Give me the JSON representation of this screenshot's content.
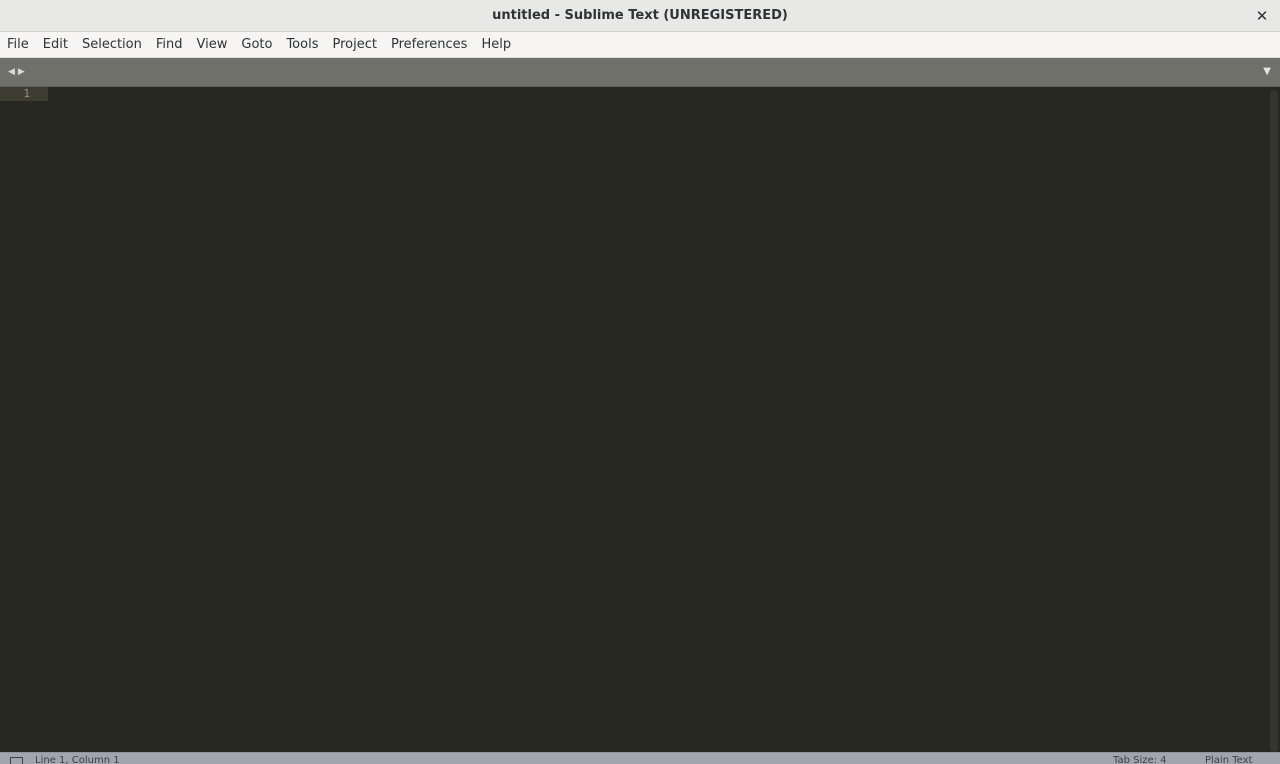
{
  "window": {
    "title": "untitled - Sublime Text (UNREGISTERED)",
    "close_glyph": "✕"
  },
  "menubar": {
    "items": [
      "File",
      "Edit",
      "Selection",
      "Find",
      "View",
      "Goto",
      "Tools",
      "Project",
      "Preferences",
      "Help"
    ]
  },
  "tabbar": {
    "prev_glyph": "◀",
    "next_glyph": "▶",
    "dropdown_glyph": "▼"
  },
  "editor": {
    "line_numbers": [
      "1"
    ],
    "theme_colors": {
      "background": "#272822",
      "gutter_highlight": "#3e3d32",
      "line_number": "#8f908a"
    }
  },
  "statusbar": {
    "position": "Line 1, Column 1",
    "tab_size": "Tab Size: 4",
    "syntax": "Plain Text"
  }
}
